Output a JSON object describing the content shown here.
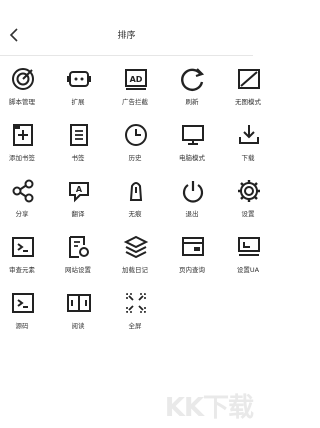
{
  "header": {
    "title": "排序",
    "back_icon": "chevron-left-icon"
  },
  "items": [
    {
      "label": "脚本管理",
      "icon": "script-target-icon"
    },
    {
      "label": "扩展",
      "icon": "extension-icon"
    },
    {
      "label": "广告拦截",
      "icon": "ad-block-icon"
    },
    {
      "label": "刷新",
      "icon": "refresh-icon"
    },
    {
      "label": "无图模式",
      "icon": "no-image-icon"
    },
    {
      "label": "添加书签",
      "icon": "add-bookmark-icon"
    },
    {
      "label": "书签",
      "icon": "bookmark-icon"
    },
    {
      "label": "历史",
      "icon": "history-icon"
    },
    {
      "label": "电脑模式",
      "icon": "desktop-mode-icon"
    },
    {
      "label": "下载",
      "icon": "download-icon"
    },
    {
      "label": "分享",
      "icon": "share-icon"
    },
    {
      "label": "翻译",
      "icon": "translate-icon"
    },
    {
      "label": "无痕",
      "icon": "incognito-icon"
    },
    {
      "label": "退出",
      "icon": "power-icon"
    },
    {
      "label": "设置",
      "icon": "settings-icon"
    },
    {
      "label": "审查元素",
      "icon": "inspect-element-icon"
    },
    {
      "label": "网站设置",
      "icon": "site-settings-icon"
    },
    {
      "label": "加载日记",
      "icon": "load-log-icon"
    },
    {
      "label": "页内查询",
      "icon": "find-in-page-icon"
    },
    {
      "label": "设置UA",
      "icon": "user-agent-icon"
    },
    {
      "label": "源码",
      "icon": "source-code-icon"
    },
    {
      "label": "阅读",
      "icon": "reader-mode-icon"
    },
    {
      "label": "全屏",
      "icon": "fullscreen-icon"
    }
  ],
  "watermark": "KK下载"
}
